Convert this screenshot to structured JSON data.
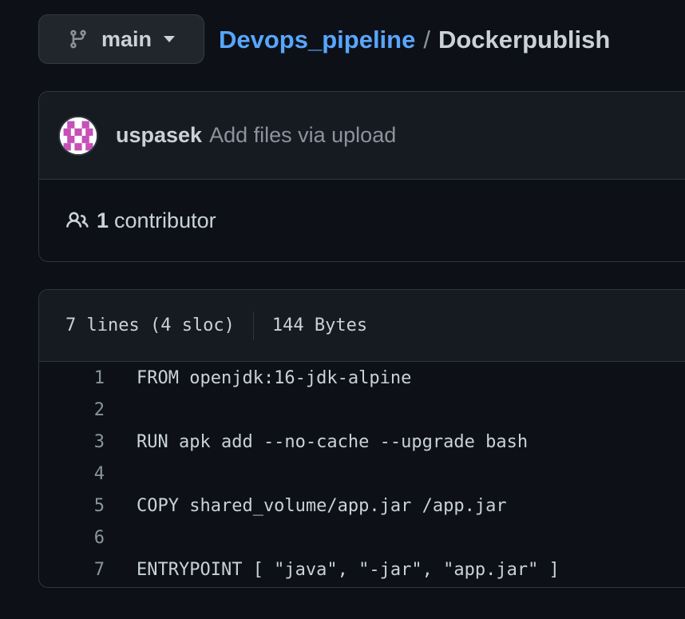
{
  "branch": {
    "name": "main",
    "icon": "git-branch-icon",
    "caret_icon": "triangle-down-icon"
  },
  "breadcrumb": {
    "repo": "Devops_pipeline",
    "separator": "/",
    "file": "Dockerpublish"
  },
  "commit": {
    "author": "uspasek",
    "message": "Add files via upload",
    "avatar_colors": [
      "#c650b8",
      "#ffffff"
    ]
  },
  "contributors": {
    "icon": "people-icon",
    "count": "1",
    "label": "contributor"
  },
  "file": {
    "lines_info": "7 lines (4 sloc)",
    "size": "144 Bytes",
    "lines": [
      {
        "number": "1",
        "text": "FROM openjdk:16-jdk-alpine"
      },
      {
        "number": "2",
        "text": ""
      },
      {
        "number": "3",
        "text": "RUN apk add --no-cache --upgrade bash"
      },
      {
        "number": "4",
        "text": ""
      },
      {
        "number": "5",
        "text": "COPY shared_volume/app.jar /app.jar"
      },
      {
        "number": "6",
        "text": ""
      },
      {
        "number": "7",
        "text": "ENTRYPOINT [ \"java\", \"-jar\", \"app.jar\" ]"
      }
    ]
  },
  "colors": {
    "background": "#0d1117",
    "panel": "#161b22",
    "border": "#30363d",
    "link": "#58a6ff",
    "text": "#c9d1d9",
    "muted": "#8b949e"
  }
}
